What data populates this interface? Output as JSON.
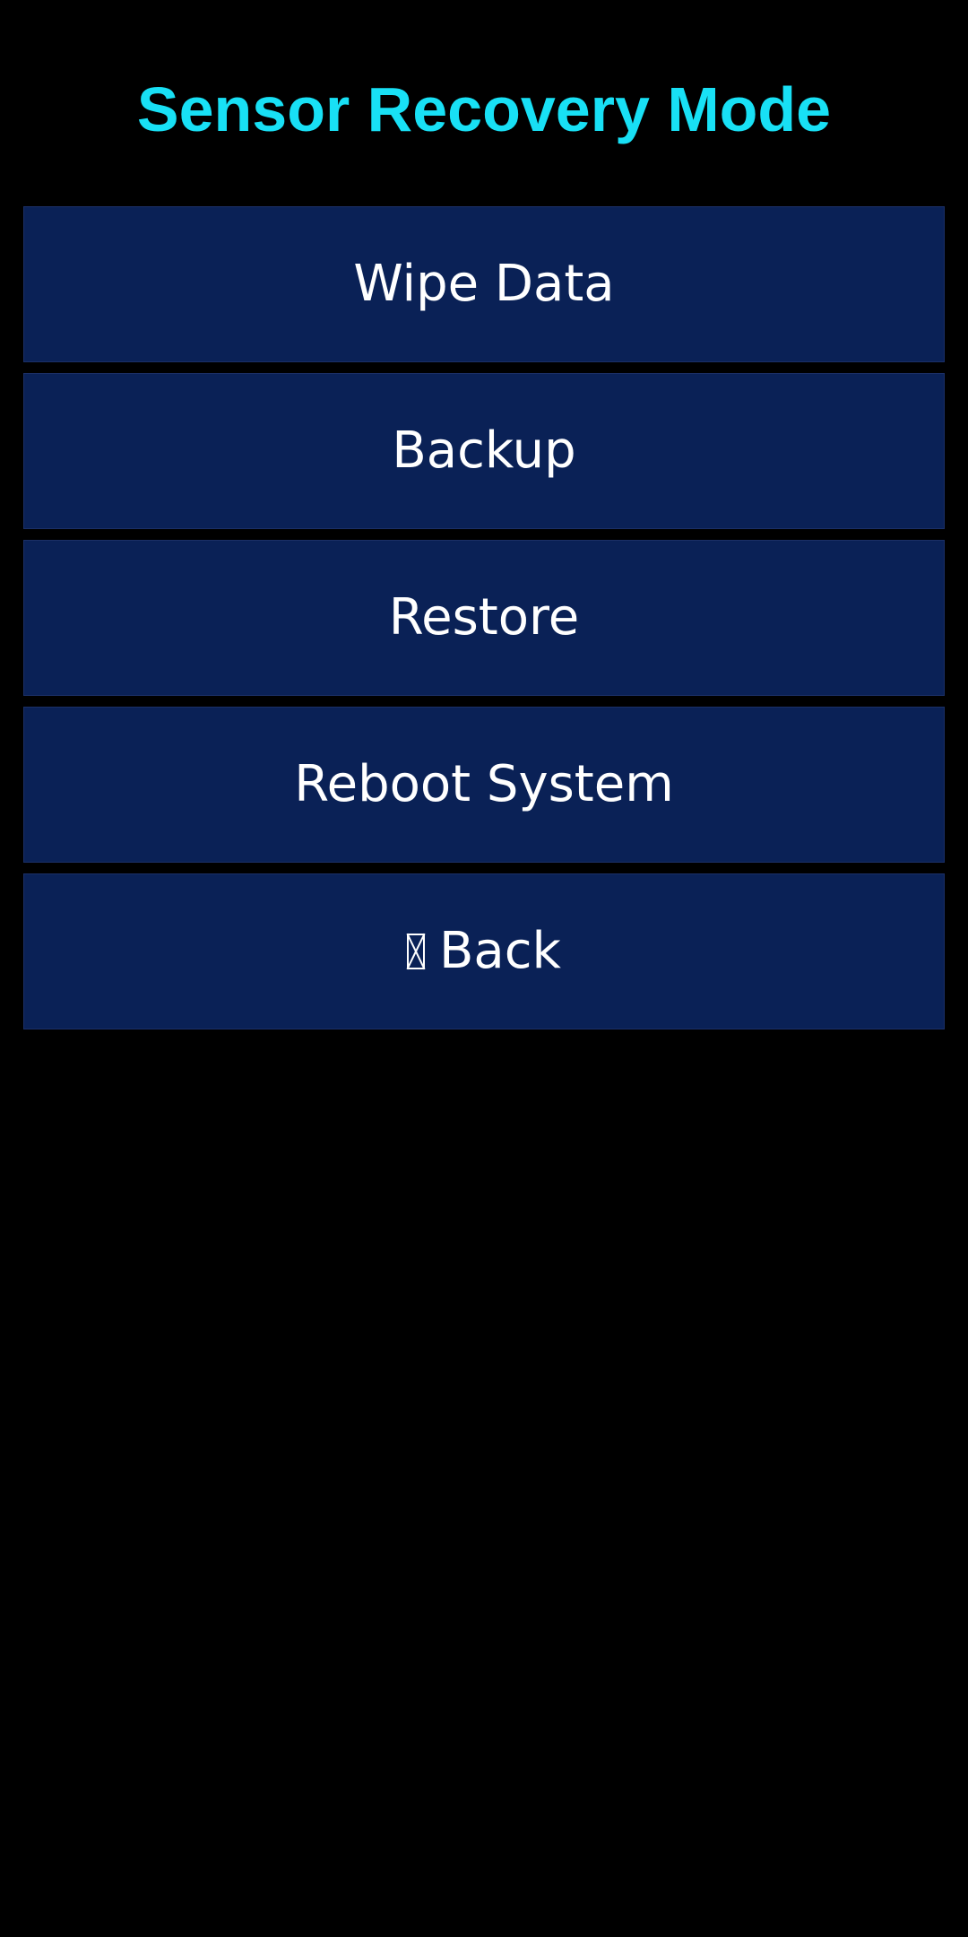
{
  "screen": {
    "title": "Sensor Recovery Mode"
  },
  "menu": {
    "items": [
      {
        "label": "Wipe Data"
      },
      {
        "label": "Backup"
      },
      {
        "label": "Restore"
      },
      {
        "label": "Reboot System"
      },
      {
        "label": "Back",
        "icon": "missing-glyph-icon"
      }
    ]
  },
  "colors": {
    "background": "#000000",
    "title": "#18E0F5",
    "button_background": "#0A2156",
    "button_text": "#FFFFFF"
  }
}
